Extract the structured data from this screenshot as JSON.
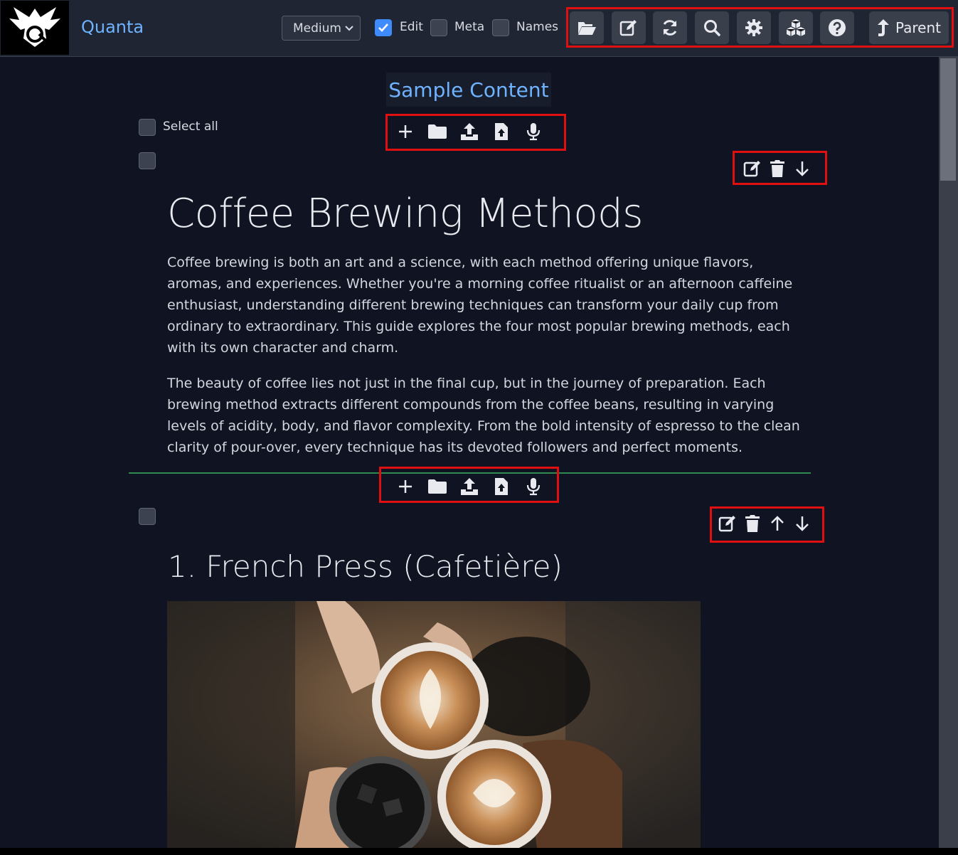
{
  "app": {
    "name": "Quanta"
  },
  "toolbar": {
    "size_value": "Medium",
    "edit_label": "Edit",
    "edit_checked": true,
    "meta_label": "Meta",
    "names_label": "Names",
    "parent_label": "Parent",
    "buttons": [
      "folder-open-icon",
      "edit-icon",
      "refresh-icon",
      "search-icon",
      "gear-icon",
      "cubes-icon",
      "help-icon"
    ]
  },
  "page": {
    "title": "Sample Content",
    "select_all_label": "Select all"
  },
  "nodes": [
    {
      "heading": "Coffee Brewing Methods",
      "paragraphs": [
        "Coffee brewing is both an art and a science, with each method offering unique flavors, aromas, and experiences. Whether you're a morning coffee ritualist or an afternoon caffeine enthusiast, understanding different brewing techniques can transform your daily cup from ordinary to extraordinary. This guide explores the four most popular brewing methods, each with its own character and charm.",
        "The beauty of coffee lies not just in the final cup, but in the journey of preparation. Each brewing method extracts different compounds from the coffee beans, resulting in varying levels of acidity, body, and flavor complexity. From the bold intensity of espresso to the clean clarity of pour-over, every technique has its devoted followers and perfect moments."
      ]
    },
    {
      "heading": "1. French Press (Cafetière)"
    }
  ],
  "insert_actions": [
    "plus-icon",
    "folder-icon",
    "upload-icon",
    "file-upload-icon",
    "microphone-icon"
  ],
  "colors": {
    "accent": "#6fb3ff",
    "highlight": "#e01010",
    "divider": "#2f8a4f",
    "background": "#0f1322"
  }
}
